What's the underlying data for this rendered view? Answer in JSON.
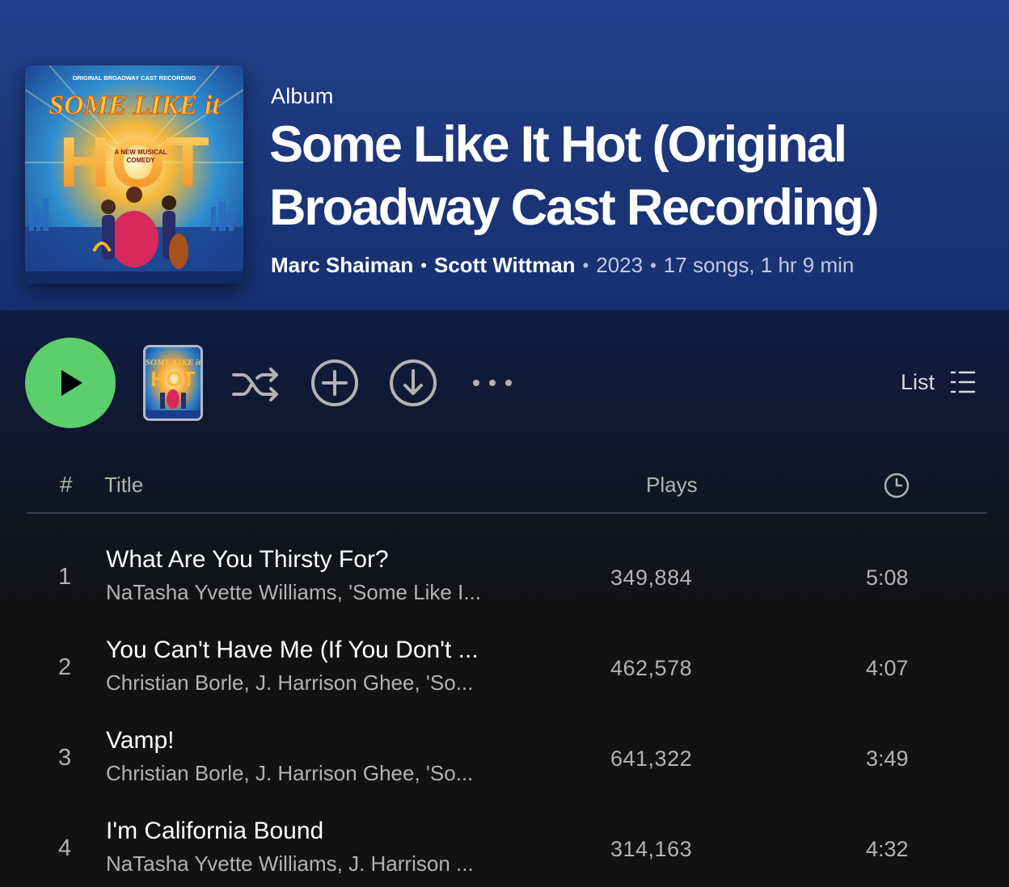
{
  "header": {
    "type_label": "Album",
    "title": "Some Like It Hot (Original Broadway Cast Recording)",
    "artists": [
      "Marc Shaiman",
      "Scott Wittman"
    ],
    "year": "2023",
    "summary": "17 songs, 1 hr 9 min",
    "separator": "•"
  },
  "cover": {
    "top_text": "ORIGINAL BROADWAY CAST RECORDING",
    "line1": "SOME LIKE it",
    "line2": "HOT",
    "tagline1": "A NEW MUSICAL",
    "tagline2": "COMEDY",
    "thumb_line1": "SOME LIKE it",
    "thumb_line2": "HOT"
  },
  "controls": {
    "view_label": "List",
    "more_label": "•••",
    "icons": [
      "play-icon",
      "shuffle-icon",
      "add-icon",
      "download-icon",
      "more-icon",
      "list-view-icon"
    ]
  },
  "table": {
    "header": {
      "number": "#",
      "title": "Title",
      "plays": "Plays",
      "duration_icon": "clock-icon"
    },
    "tracks": [
      {
        "number": "1",
        "title": "What Are You Thirsty For?",
        "artists": "NaTasha Yvette Williams, 'Some Like I...",
        "plays": "349,884",
        "duration": "5:08"
      },
      {
        "number": "2",
        "title": "You Can't Have Me (If You Don't ...",
        "artists": "Christian Borle, J. Harrison Ghee, 'So...",
        "plays": "462,578",
        "duration": "4:07"
      },
      {
        "number": "3",
        "title": "Vamp!",
        "artists": "Christian Borle, J. Harrison Ghee, 'So...",
        "plays": "641,322",
        "duration": "3:49"
      },
      {
        "number": "4",
        "title": "I'm California Bound",
        "artists": "NaTasha Yvette Williams, J. Harrison ...",
        "plays": "314,163",
        "duration": "4:32"
      }
    ]
  },
  "colors": {
    "accent_green": "#5ccf6c",
    "header_blue": "#1e3a84",
    "background": "#121212"
  }
}
